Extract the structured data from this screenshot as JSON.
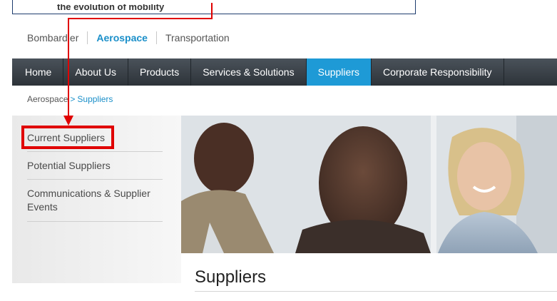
{
  "callout": {
    "tagline": "the evolution of mobility"
  },
  "divisions": [
    {
      "label": "Bombardier"
    },
    {
      "label": "Aerospace"
    },
    {
      "label": "Transportation"
    }
  ],
  "nav": {
    "items": [
      {
        "label": "Home"
      },
      {
        "label": "About Us"
      },
      {
        "label": "Products"
      },
      {
        "label": "Services & Solutions"
      },
      {
        "label": "Suppliers"
      },
      {
        "label": "Corporate Responsibility"
      }
    ]
  },
  "breadcrumb": {
    "parent": "Aerospace",
    "separator": ">",
    "current": "Suppliers"
  },
  "sidebar": {
    "items": [
      {
        "label": "Current Suppliers"
      },
      {
        "label": "Potential Suppliers"
      },
      {
        "label": "Communications & Supplier Events"
      }
    ]
  },
  "main": {
    "heading": "Suppliers"
  },
  "colors": {
    "accent": "#1e9ad6",
    "nav_bg": "#2d3339",
    "highlight": "#e00000"
  }
}
